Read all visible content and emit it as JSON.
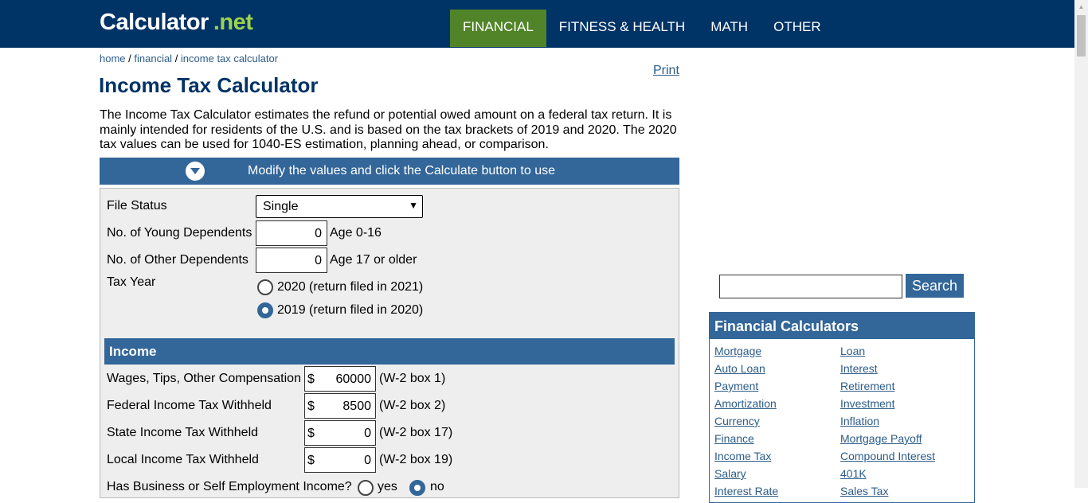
{
  "header": {
    "logo_main": "Calculator",
    "logo_ext": ".net",
    "nav": [
      "FINANCIAL",
      "FITNESS & HEALTH",
      "MATH",
      "OTHER"
    ]
  },
  "breadcrumb": {
    "home": "home",
    "sep": " / ",
    "financial": "financial",
    "current": "income tax calculator"
  },
  "print_label": "Print",
  "title": "Income Tax Calculator",
  "intro": "The Income Tax Calculator estimates the refund or potential owed amount on a federal tax return. It is mainly intended for residents of the U.S. and is based on the tax brackets of 2019 and 2020. The 2020 tax values can be used for 1040-ES estimation, planning ahead, or comparison.",
  "modify_bar": "Modify the values and click the Calculate button to use",
  "form": {
    "file_status_label": "File Status",
    "file_status_value": "Single",
    "young_dependents_label": "No. of Young Dependents",
    "young_dependents_value": "0",
    "young_dependents_note": "Age 0-16",
    "other_dependents_label": "No. of Other Dependents",
    "other_dependents_value": "0",
    "other_dependents_note": "Age 17 or older",
    "tax_year_label": "Tax Year",
    "tax_year_option_2020": "2020 (return filed in 2021)",
    "tax_year_option_2019": "2019 (return filed in 2020)",
    "tax_year_selected": "2019"
  },
  "income": {
    "heading": "Income",
    "currency": "$",
    "rows": [
      {
        "label": "Wages, Tips, Other Compensation",
        "value": "60000",
        "note": "(W-2 box 1)"
      },
      {
        "label": "Federal Income Tax Withheld",
        "value": "8500",
        "note": "(W-2 box 2)"
      },
      {
        "label": "State Income Tax Withheld",
        "value": "0",
        "note": "(W-2 box 17)"
      },
      {
        "label": "Local Income Tax Withheld",
        "value": "0",
        "note": "(W-2 box 19)"
      }
    ],
    "business_label": "Has Business or Self Employment Income?",
    "business_yes": "yes",
    "business_no": "no"
  },
  "sidebar": {
    "search_button": "Search",
    "search_value": "",
    "financial_heading": "Financial Calculators",
    "left_links": [
      "Mortgage",
      "Auto Loan",
      "Payment",
      "Amortization",
      "Currency",
      "Finance",
      "Income Tax",
      "Salary",
      "Interest Rate"
    ],
    "right_links": [
      "Loan",
      "Interest",
      "Retirement",
      "Investment",
      "Inflation",
      "Mortgage Payoff",
      "Compound Interest",
      "401K",
      "Sales Tax"
    ]
  },
  "colors": {
    "header_bg": "#003366",
    "active_nav": "#518428",
    "accent": "#336699",
    "logo_ext": "#9bd34b"
  }
}
